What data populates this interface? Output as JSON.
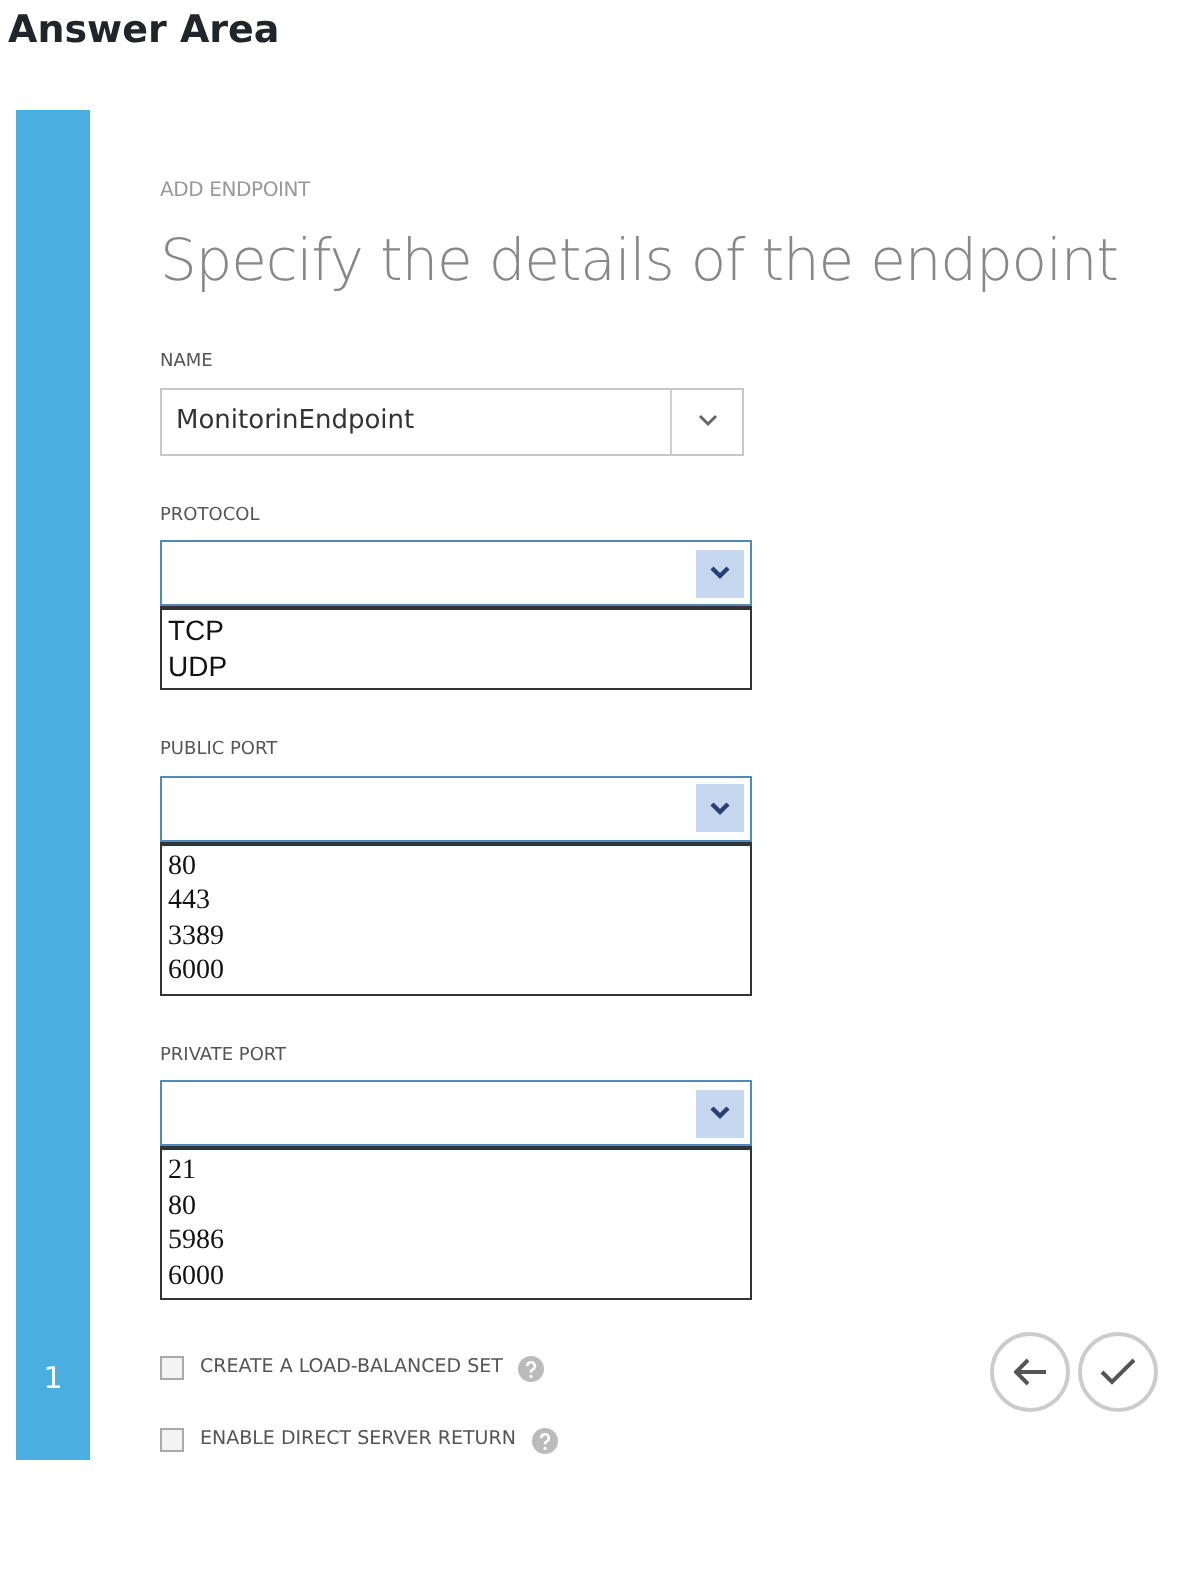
{
  "heading": "Answer Area",
  "wizard": {
    "step": "1",
    "subtitle": "ADD ENDPOINT",
    "title": "Specify the details of the endpoint"
  },
  "fields": [
    {
      "kind": "combo",
      "label": "NAME",
      "value": "MonitorinEndpoint"
    },
    {
      "kind": "dropdown",
      "label": "PROTOCOL",
      "options": [
        "TCP",
        "UDP"
      ]
    },
    {
      "kind": "dropdown",
      "label": "PUBLIC PORT",
      "options": [
        "80",
        "443",
        "3389",
        "6000"
      ]
    },
    {
      "kind": "dropdown",
      "label": "PRIVATE PORT",
      "options": [
        "21",
        "80",
        "5986",
        "6000"
      ]
    }
  ],
  "checkboxes": [
    {
      "label": "CREATE A LOAD-BALANCED SET",
      "checked": false
    },
    {
      "label": "ENABLE DIRECT SERVER RETURN",
      "checked": false
    }
  ]
}
